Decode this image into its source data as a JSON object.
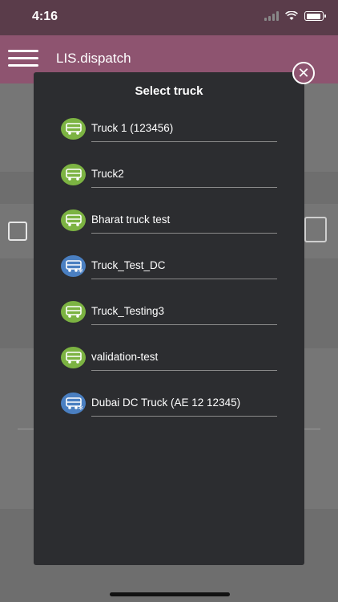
{
  "status_bar": {
    "time": "4:16"
  },
  "app_bar": {
    "title": "LIS.dispatch"
  },
  "modal": {
    "title": "Select truck",
    "close_icon": "close-circle-icon",
    "trucks": [
      {
        "label": "Truck 1 (123456)",
        "icon": "truck-icon",
        "color": "#7cb342"
      },
      {
        "label": "Truck2",
        "icon": "truck-icon",
        "color": "#7cb342"
      },
      {
        "label": "Bharat truck test",
        "icon": "truck-icon",
        "color": "#7cb342"
      },
      {
        "label": "Truck_Test_DC",
        "icon": "truck-snowflake-icon",
        "color": "#4a7fc1"
      },
      {
        "label": "Truck_Testing3",
        "icon": "truck-icon",
        "color": "#7cb342"
      },
      {
        "label": "validation-test",
        "icon": "truck-icon",
        "color": "#7cb342"
      },
      {
        "label": "Dubai DC Truck (AE 12 12345)",
        "icon": "truck-snowflake-icon",
        "color": "#4a7fc1"
      }
    ]
  },
  "colors": {
    "header": "#8e5470",
    "modal_bg": "#2c2d30",
    "green": "#7cb342",
    "blue": "#4a7fc1"
  }
}
